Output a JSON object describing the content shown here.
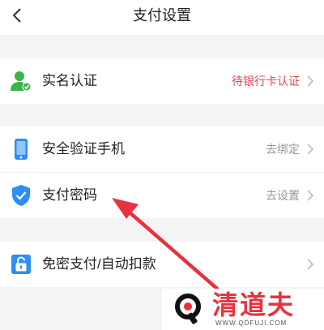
{
  "header": {
    "title": "支付设置",
    "back_icon": "chevron-left-icon"
  },
  "sections": [
    {
      "rows": [
        {
          "label": "实名认证",
          "value": "待银行卡认证",
          "value_color": "#e8455a",
          "icon": "user-verified-icon"
        }
      ]
    },
    {
      "rows": [
        {
          "label": "安全验证手机",
          "value": "去绑定",
          "icon": "phone-icon"
        },
        {
          "label": "支付密码",
          "value": "去设置",
          "icon": "shield-check-icon"
        }
      ]
    },
    {
      "rows": [
        {
          "label": "免密支付/自动扣款",
          "value": "",
          "icon": "lock-icon"
        }
      ]
    }
  ],
  "watermark": {
    "name": "清道夫",
    "url": "WWW.QDFUJI.COM"
  },
  "colors": {
    "accent_blue": "#2b8ff5",
    "accent_green": "#3bb34a",
    "annotation_red": "#e8323c"
  }
}
